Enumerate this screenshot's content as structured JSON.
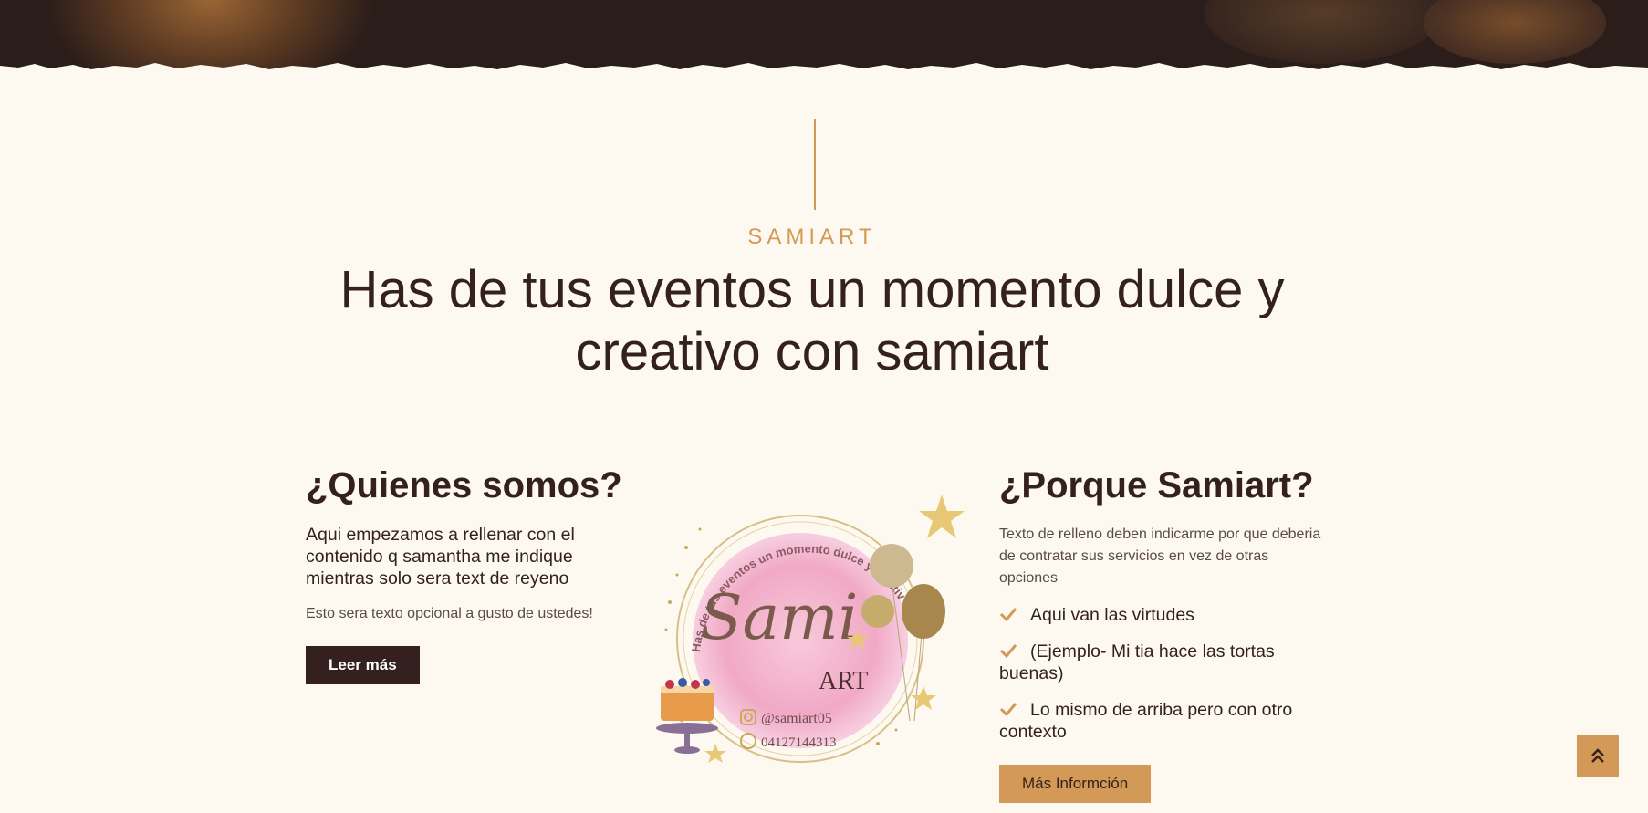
{
  "intro": {
    "eyebrow": "SAMIART",
    "headline": "Has de tus eventos un momento dulce y creativo con samiart"
  },
  "about": {
    "title": "¿Quienes somos?",
    "lead": "Aqui empezamos a rellenar con el contenido q samantha me indique mientras solo sera text de reyeno",
    "note": "Esto sera texto opcional a gusto de ustedes!",
    "button_label": "Leer más"
  },
  "logo": {
    "arc_text": "Has de tus eventos un momento dulce y creativo con",
    "script": "Sami",
    "word": "ART",
    "instagram": "@samiart05",
    "phone": "04127144313"
  },
  "why": {
    "title": "¿Porque Samiart?",
    "lead": "Texto de relleno deben indicarme por que deberia de contratar sus servicios en vez de otras opciones",
    "items": [
      "Aqui van las virtudes",
      "(Ejemplo- Mi tia hace las tortas buenas)",
      "Lo mismo de arriba pero con otro contexto"
    ],
    "button_label": "Más Informción"
  },
  "icons": {
    "check": "check-icon",
    "scroll_top": "double-chevron-up-icon",
    "instagram": "instagram-icon",
    "whatsapp": "whatsapp-icon"
  },
  "colors": {
    "background": "#fdf9f1",
    "accent": "#d39a57",
    "dark": "#34201f",
    "logo_pink": "#f3b4cc"
  }
}
